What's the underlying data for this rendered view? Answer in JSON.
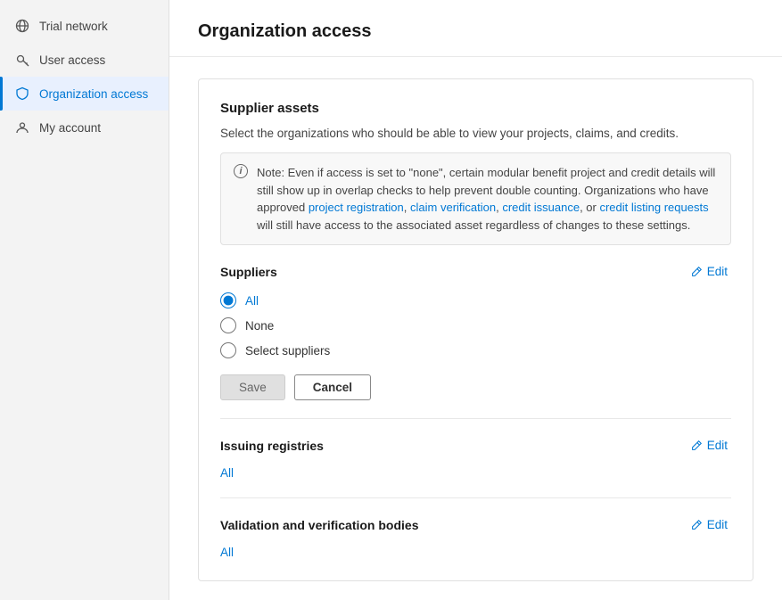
{
  "sidebar": {
    "items": [
      {
        "id": "trial-network",
        "label": "Trial network",
        "icon": "globe-icon",
        "active": false
      },
      {
        "id": "user-access",
        "label": "User access",
        "icon": "key-icon",
        "active": false
      },
      {
        "id": "organization-access",
        "label": "Organization access",
        "icon": "shield-icon",
        "active": true
      },
      {
        "id": "my-account",
        "label": "My account",
        "icon": "person-icon",
        "active": false
      }
    ]
  },
  "page": {
    "title": "Organization access"
  },
  "supplier_assets": {
    "section_title": "Supplier assets",
    "description": "Select the organizations who should be able to view your projects, claims, and credits.",
    "notice_text": "Note: Even if access is set to \"none\", certain modular benefit project and credit details will still show up in overlap checks to help prevent double counting. Organizations who have approved project registration, claim verification, credit issuance, or credit listing requests will still have access to the associated asset regardless of changes to these settings.",
    "suppliers_label": "Suppliers",
    "edit_label": "Edit",
    "radio_options": [
      {
        "id": "all",
        "label": "All",
        "checked": true
      },
      {
        "id": "none",
        "label": "None",
        "checked": false
      },
      {
        "id": "select",
        "label": "Select suppliers",
        "checked": false
      }
    ],
    "save_label": "Save",
    "cancel_label": "Cancel"
  },
  "issuing_registries": {
    "label": "Issuing registries",
    "edit_label": "Edit",
    "value": "All"
  },
  "validation_bodies": {
    "label": "Validation and verification bodies",
    "edit_label": "Edit",
    "value": "All"
  }
}
